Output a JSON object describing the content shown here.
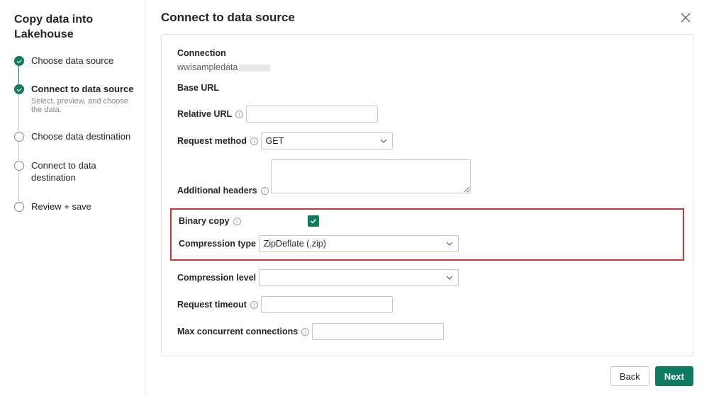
{
  "sidebar": {
    "title": "Copy data into Lakehouse",
    "steps": [
      {
        "label": "Choose data source",
        "sub": "",
        "status": "done"
      },
      {
        "label": "Connect to data source",
        "sub": "Select, preview, and choose the data.",
        "status": "current"
      },
      {
        "label": "Choose data destination",
        "sub": "",
        "status": "future"
      },
      {
        "label": "Connect to data destination",
        "sub": "",
        "status": "future"
      },
      {
        "label": "Review + save",
        "sub": "",
        "status": "future"
      }
    ]
  },
  "header": {
    "title": "Connect to data source"
  },
  "form": {
    "connection_label": "Connection",
    "connection_value": "wwisampledata",
    "base_url_label": "Base URL",
    "relative_url_label": "Relative URL",
    "relative_url_value": "",
    "request_method_label": "Request method",
    "request_method_value": "GET",
    "additional_headers_label": "Additional headers",
    "additional_headers_value": "",
    "binary_copy_label": "Binary copy",
    "binary_copy_checked": true,
    "compression_type_label": "Compression type",
    "compression_type_value": "ZipDeflate (.zip)",
    "compression_level_label": "Compression level",
    "compression_level_value": "",
    "request_timeout_label": "Request timeout",
    "request_timeout_value": "",
    "max_conn_label": "Max concurrent connections",
    "max_conn_value": ""
  },
  "footer": {
    "back_label": "Back",
    "next_label": "Next"
  }
}
